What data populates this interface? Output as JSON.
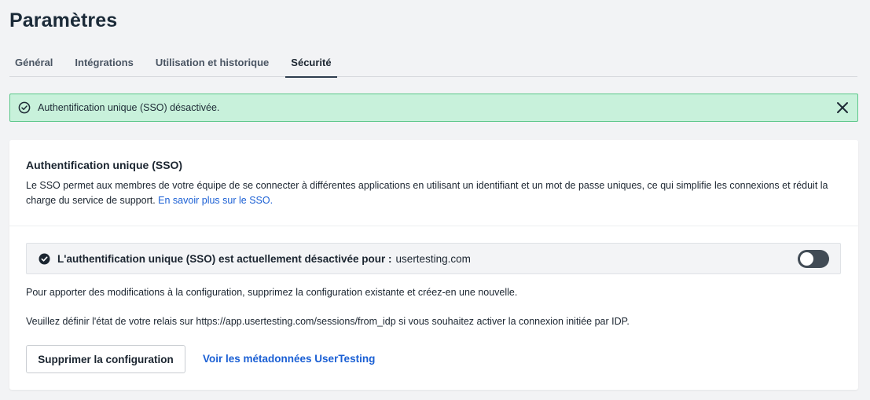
{
  "page": {
    "title": "Paramètres"
  },
  "tabs": [
    {
      "label": "Général",
      "active": false
    },
    {
      "label": "Intégrations",
      "active": false
    },
    {
      "label": "Utilisation et historique",
      "active": false
    },
    {
      "label": "Sécurité",
      "active": true
    }
  ],
  "banner": {
    "message": "Authentification unique (SSO) désactivée.",
    "icon": "check-circle-icon",
    "close_icon": "close-icon",
    "background": "#c8f1db",
    "border": "#5bc789"
  },
  "sso": {
    "title": "Authentification unique (SSO)",
    "description": "Le SSO permet aux membres de votre équipe de se connecter à différentes applications en utilisant un identifiant et un mot de passe uniques, ce qui simplifie les connexions et réduit la charge du service de support.",
    "learn_more": "En savoir plus sur le SSO.",
    "status_label": "L'authentification unique (SSO) est actuellement désactivée pour :",
    "status_domain": "usertesting.com",
    "toggle_enabled": false,
    "info_config": "Pour apporter des modifications à la configuration, supprimez la configuration existante et créez-en une nouvelle.",
    "info_relay": "Veuillez définir l'état de votre relais sur https://app.usertesting.com/sessions/from_idp si vous souhaitez activer la connexion initiée par IDP.",
    "delete_button": "Supprimer la configuration",
    "metadata_link": "Voir les métadonnées UserTesting",
    "link_color": "#1a5fd4"
  }
}
